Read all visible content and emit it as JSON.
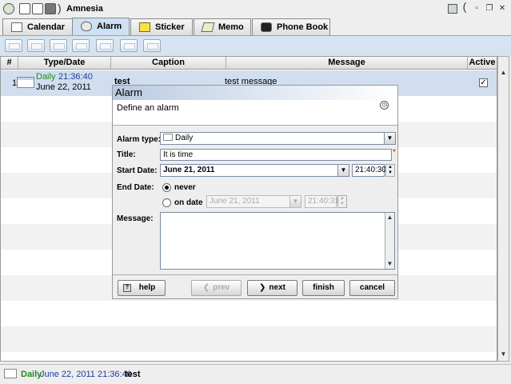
{
  "app": {
    "title": "Amnesia",
    "paren": ")",
    "paren_right": "(",
    "restore_glyph": "❐",
    "close_glyph": "✕"
  },
  "tabs": [
    {
      "label": "Calendar"
    },
    {
      "label": "Alarm"
    },
    {
      "label": "Sticker"
    },
    {
      "label": "Memo"
    },
    {
      "label": "Phone Book"
    }
  ],
  "table": {
    "columns": [
      "#",
      "Type/Date",
      "Caption",
      "Message",
      "Active"
    ],
    "rows": [
      {
        "num": "1",
        "type": "Daily",
        "time": "21:36:40",
        "date": "June 22, 2011",
        "caption": "test",
        "message": "test message",
        "active": true
      }
    ]
  },
  "dialog": {
    "title": "Alarm",
    "subtitle": "Define an alarm",
    "alarm_type_label": "Alarm type:",
    "alarm_type_value": "Daily",
    "title_label": "Title:",
    "title_value": "It is time",
    "required_mark": "*",
    "start_date_label": "Start Date:",
    "start_date_value": "June 21, 2011",
    "start_time_value": "21:40:30",
    "end_date_label": "End Date:",
    "end_never_label": "never",
    "end_on_date_label": "on date",
    "end_date_value": "June 21, 2011",
    "end_time_value": "21:40:31",
    "message_label": "Message:",
    "buttons": {
      "help": "help",
      "prev": "prev",
      "next": "next",
      "finish": "finish",
      "cancel": "cancel"
    }
  },
  "status": {
    "type": "Daily",
    "datetime": "June 22, 2011 21:36:40",
    "caption": "test"
  },
  "colors": {
    "type_green": "#1f8c1f",
    "time_blue": "#1a3fa0",
    "selection": "#d0def0"
  },
  "glyphs": {
    "check": "✓",
    "down": "▼",
    "up": "▲",
    "prev": "❮",
    "next": "❯"
  }
}
